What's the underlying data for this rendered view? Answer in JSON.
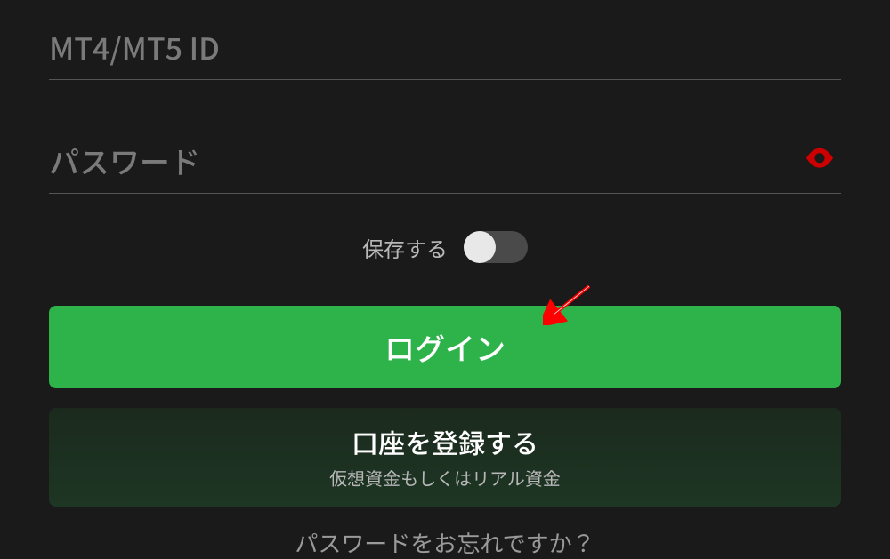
{
  "id_field": {
    "placeholder": "MT4/MT5 ID",
    "value": ""
  },
  "password_field": {
    "placeholder": "パスワード",
    "value": ""
  },
  "save_toggle": {
    "label": "保存する",
    "enabled": false
  },
  "login_button": {
    "label": "ログイン"
  },
  "register_button": {
    "main_label": "口座を登録する",
    "sub_label": "仮想資金もしくはリアル資金"
  },
  "forgot_password": {
    "label": "パスワードをお忘れですか？"
  },
  "colors": {
    "primary": "#2eb24a",
    "eye_icon": "#cc0000",
    "arrow": "#ff0000"
  }
}
